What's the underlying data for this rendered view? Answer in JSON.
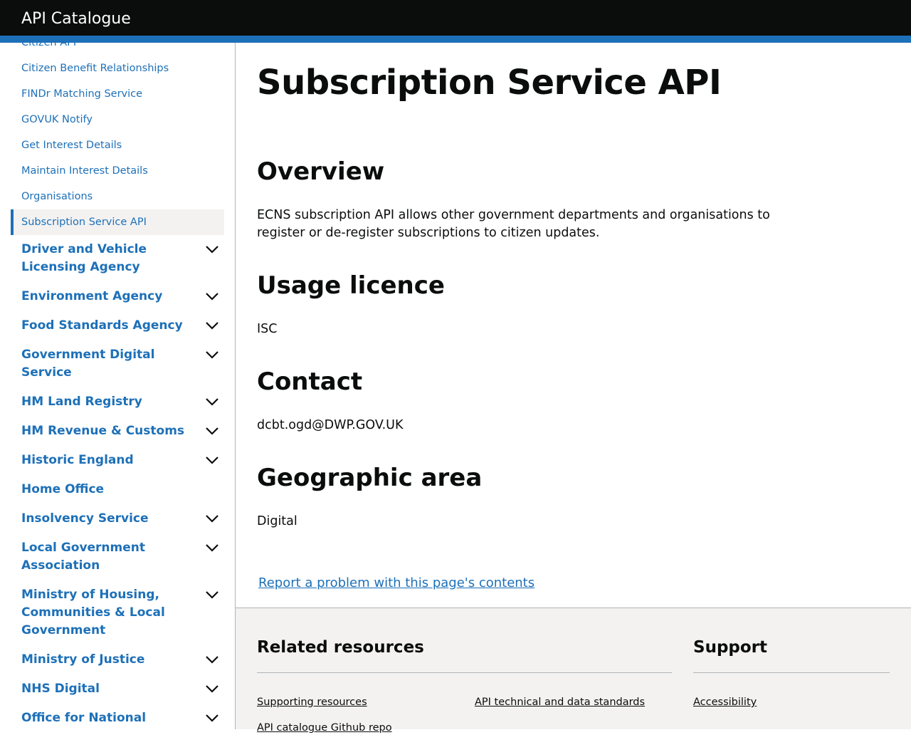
{
  "header": {
    "title": "API Catalogue"
  },
  "sidebar": {
    "sub_items": [
      {
        "label": "Citizen API"
      },
      {
        "label": "Citizen Benefit Relationships"
      },
      {
        "label": "FINDr Matching Service"
      },
      {
        "label": "GOVUK Notify"
      },
      {
        "label": "Get Interest Details"
      },
      {
        "label": "Maintain Interest Details"
      },
      {
        "label": "Organisations"
      }
    ],
    "active_item": {
      "label": "Subscription Service API"
    },
    "orgs": [
      {
        "label": "Driver and Vehicle Licensing Agency",
        "expandable": true
      },
      {
        "label": "Environment Agency",
        "expandable": true
      },
      {
        "label": "Food Standards Agency",
        "expandable": true
      },
      {
        "label": "Government Digital Service",
        "expandable": true
      },
      {
        "label": "HM Land Registry",
        "expandable": true
      },
      {
        "label": "HM Revenue & Customs",
        "expandable": true
      },
      {
        "label": "Historic England",
        "expandable": true
      },
      {
        "label": "Home Office",
        "expandable": false
      },
      {
        "label": "Insolvency Service",
        "expandable": true
      },
      {
        "label": "Local Government Association",
        "expandable": true
      },
      {
        "label": "Ministry of Housing, Communities & Local Government",
        "expandable": true
      },
      {
        "label": "Ministry of Justice",
        "expandable": true
      },
      {
        "label": "NHS Digital",
        "expandable": true
      },
      {
        "label": "Office for National",
        "expandable": true
      }
    ]
  },
  "main": {
    "title": "Subscription Service API",
    "sections": [
      {
        "heading": "Overview",
        "text": "ECNS subscription API allows other government departments and organisations to register or de-register subscriptions to citizen updates."
      },
      {
        "heading": "Usage licence",
        "text": "ISC"
      },
      {
        "heading": "Contact",
        "text": "dcbt.ogd@DWP.GOV.UK"
      },
      {
        "heading": "Geographic area",
        "text": "Digital"
      }
    ],
    "report_link": "Report a problem with this page's contents"
  },
  "footer": {
    "related_heading": "Related resources",
    "support_heading": "Support",
    "links": {
      "supporting_resources": "Supporting resources",
      "api_standards": "API technical and data standards",
      "accessibility": "Accessibility",
      "github_repo": "API catalogue Github repo"
    }
  },
  "colors": {
    "link": "#1d70b8",
    "header_bg": "#0b0c0c",
    "accent_bar": "#1d70b8",
    "footer_bg": "#f3f2f1"
  }
}
